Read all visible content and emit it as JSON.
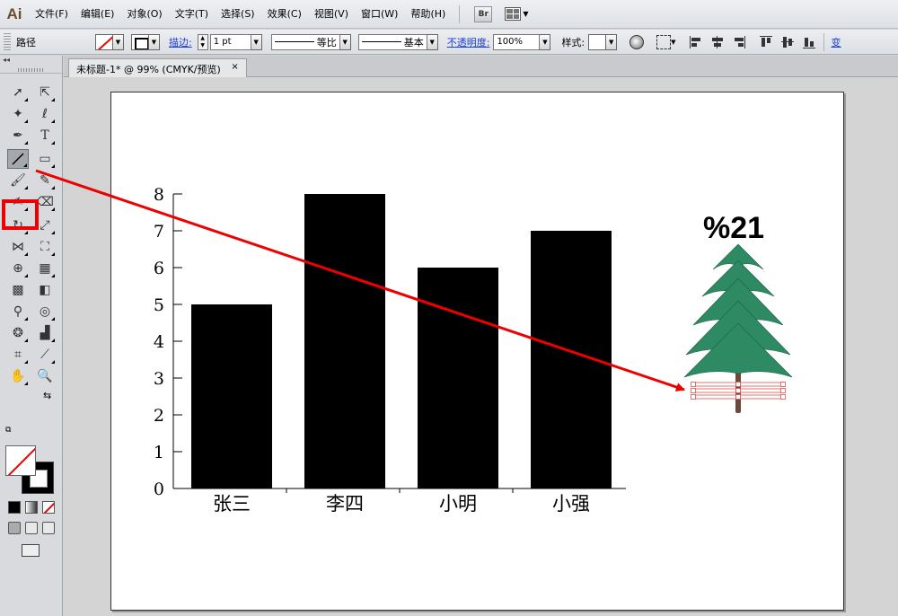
{
  "menubar": {
    "logo": "Ai",
    "items": [
      "文件(F)",
      "编辑(E)",
      "对象(O)",
      "文字(T)",
      "选择(S)",
      "效果(C)",
      "视图(V)",
      "窗口(W)",
      "帮助(H)"
    ],
    "bridge": "Br"
  },
  "control": {
    "selection_label": "路径",
    "stroke_link": "描边:",
    "stroke_weight": "1 pt",
    "profile": "等比",
    "brush": "基本",
    "opacity_link": "不透明度:",
    "opacity_value": "100%",
    "style_label": "样式:",
    "overflow_text": "变"
  },
  "document": {
    "tab_title": "未标题-1* @ 99% (CMYK/预览)",
    "close": "×"
  },
  "toolbox": {
    "collapse": "◂◂"
  },
  "chart_data": {
    "type": "bar",
    "categories": [
      "张三",
      "李四",
      "小明",
      "小强"
    ],
    "values": [
      5,
      8,
      6,
      7
    ],
    "ylim": [
      0,
      8
    ],
    "yticks": [
      "0",
      "1",
      "2",
      "3",
      "4",
      "5",
      "6",
      "7",
      "8"
    ],
    "bar_color": "#000000"
  },
  "annotation": {
    "tree_label": "%21",
    "arrow_color": "#ee0000",
    "tree_color": "#2e8a62"
  }
}
